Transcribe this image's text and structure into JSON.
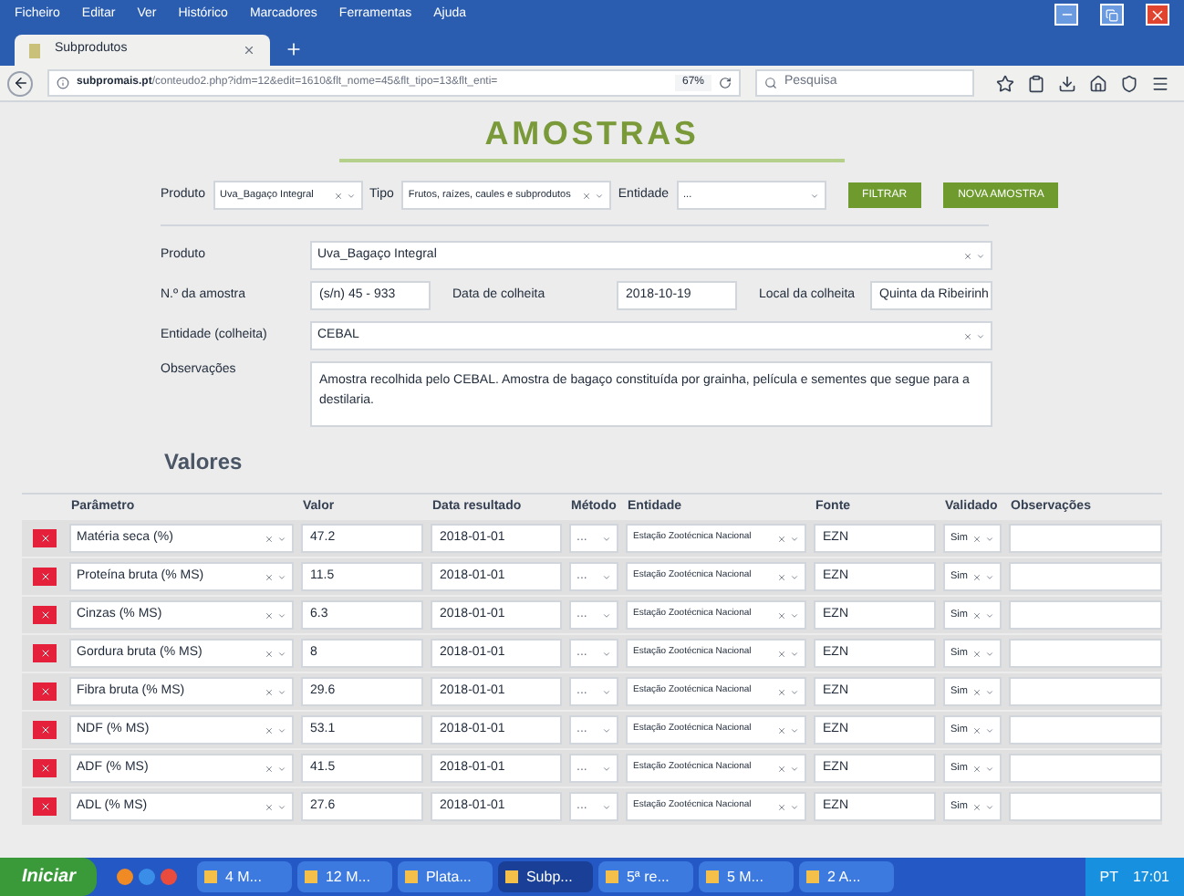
{
  "browser": {
    "menu": [
      "Ficheiro",
      "Editar",
      "Ver",
      "Histórico",
      "Marcadores",
      "Ferramentas",
      "Ajuda"
    ],
    "tab": {
      "title": "Subprodutos",
      "selected": true
    },
    "url": {
      "host": "subpromais.pt",
      "path": "/conteudo2.php?idm=12&edit=1610&flt_nome=45&flt_tipo=13&flt_enti="
    },
    "zoom": "67%",
    "search": {
      "placeholder": "Pesquisa"
    }
  },
  "page": {
    "title": "AMOSTRAS",
    "filters": [
      {
        "label": "Produto",
        "value": "Uva_Bagaço Integral",
        "clearable": true
      },
      {
        "label": "Tipo",
        "value": "Frutos, raízes, caules e subprodutos",
        "clearable": true
      },
      {
        "label": "Entidade",
        "value": "...",
        "clearable": false
      }
    ],
    "filter_buttons": [
      "FILTRAR",
      "NOVA AMOSTRA"
    ],
    "form": {
      "produto": {
        "label": "Produto",
        "value": "Uva_Bagaço Integral"
      },
      "numero": {
        "label": "N.º da amostra",
        "value": "(s/n) 45 - 933"
      },
      "data": {
        "label": "Data de colheita",
        "value": "2018-10-19"
      },
      "local": {
        "label": "Local da colheita",
        "value": "Quinta da Ribeirinh"
      },
      "entidade": {
        "label": "Entidade (colheita)",
        "value": "CEBAL"
      },
      "observacoes": {
        "label": "Observações",
        "value": "Amostra recolhida  pelo CEBAL. Amostra de bagaço constituída por grainha, película e sementes que segue para a destilaria."
      }
    },
    "values_heading": "Valores",
    "table": {
      "columns": [
        "Parâmetro",
        "Valor",
        "Data resultado",
        "Método",
        "Entidade",
        "Fonte",
        "Validado",
        "Observações"
      ],
      "rows": [
        {
          "parametro": "Matéria seca (%)",
          "valor": "47.2",
          "data": "2018-01-01",
          "metodo": "...",
          "entidade": "Estação Zootécnica Nacional",
          "fonte": "EZN",
          "validado": "Sim"
        },
        {
          "parametro": "Proteína bruta (% MS)",
          "valor": "11.5",
          "data": "2018-01-01",
          "metodo": "...",
          "entidade": "Estação Zootécnica Nacional",
          "fonte": "EZN",
          "validado": "Sim"
        },
        {
          "parametro": "Cinzas (% MS)",
          "valor": "6.3",
          "data": "2018-01-01",
          "metodo": "...",
          "entidade": "Estação Zootécnica Nacional",
          "fonte": "EZN",
          "validado": "Sim"
        },
        {
          "parametro": "Gordura bruta (% MS)",
          "valor": "8",
          "data": "2018-01-01",
          "metodo": "...",
          "entidade": "Estação Zootécnica Nacional",
          "fonte": "EZN",
          "validado": "Sim"
        },
        {
          "parametro": "Fibra bruta (% MS)",
          "valor": "29.6",
          "data": "2018-01-01",
          "metodo": "...",
          "entidade": "Estação Zootécnica Nacional",
          "fonte": "EZN",
          "validado": "Sim"
        },
        {
          "parametro": "NDF (% MS)",
          "valor": "53.1",
          "data": "2018-01-01",
          "metodo": "...",
          "entidade": "Estação Zootécnica Nacional",
          "fonte": "EZN",
          "validado": "Sim"
        },
        {
          "parametro": "ADF (% MS)",
          "valor": "41.5",
          "data": "2018-01-01",
          "metodo": "...",
          "entidade": "Estação Zootécnica Nacional",
          "fonte": "EZN",
          "validado": "Sim"
        },
        {
          "parametro": "ADL (% MS)",
          "valor": "27.6",
          "data": "2018-01-01",
          "metodo": "...",
          "entidade": "Estação Zootécnica Nacional",
          "fonte": "EZN",
          "validado": "Sim"
        }
      ]
    }
  },
  "taskbar": {
    "start": "Iniciar",
    "items": [
      {
        "label": "4 M...",
        "selected": false
      },
      {
        "label": "12 M...",
        "selected": false
      },
      {
        "label": "Plata...",
        "selected": false
      },
      {
        "label": "Subp...",
        "selected": true
      },
      {
        "label": "5ª re...",
        "selected": false
      },
      {
        "label": "5 M...",
        "selected": false
      },
      {
        "label": "2 A...",
        "selected": false
      }
    ],
    "language": "PT",
    "time": "17:01"
  }
}
